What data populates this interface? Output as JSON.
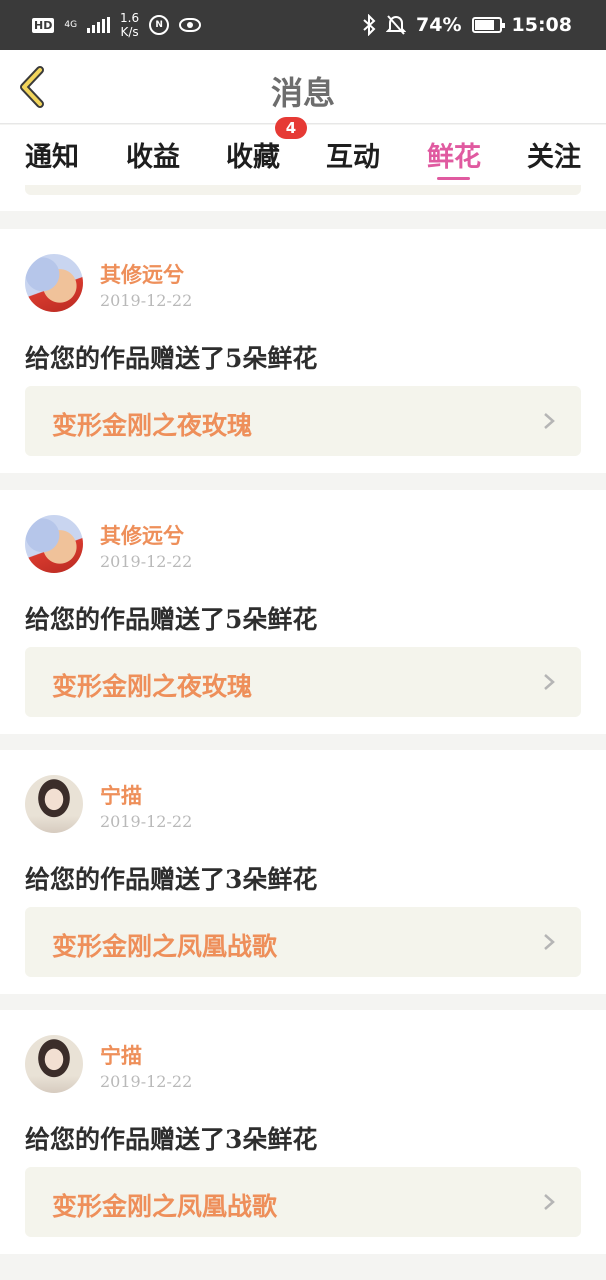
{
  "status_bar": {
    "hd": "HD",
    "network": "4G",
    "speed_value": "1.6",
    "speed_unit": "K/s",
    "circle_icon_text": "N",
    "battery": "74%",
    "time": "15:08"
  },
  "header": {
    "title": "消息"
  },
  "tabs": [
    {
      "label": "通知"
    },
    {
      "label": "收益"
    },
    {
      "label": "收藏"
    },
    {
      "label": "互动"
    },
    {
      "label": "鲜花"
    },
    {
      "label": "关注"
    }
  ],
  "active_tab": "鲜花",
  "badge": {
    "count": "4"
  },
  "colors": {
    "accent": "#e05aa0",
    "username": "#ee8f5a",
    "badge": "#e63a35"
  },
  "messages": [
    {
      "user": "其修远兮",
      "date": "2019-12-22",
      "text": "给您的作品赠送了5朵鲜花",
      "work": "变形金刚之夜玫瑰",
      "avatar": "cartoon-avatar"
    },
    {
      "user": "其修远兮",
      "date": "2019-12-22",
      "text": "给您的作品赠送了5朵鲜花",
      "work": "变形金刚之夜玫瑰",
      "avatar": "cartoon-avatar"
    },
    {
      "user": "宁描",
      "date": "2019-12-22",
      "text": "给您的作品赠送了3朵鲜花",
      "work": "变形金刚之凤凰战歌",
      "avatar": "girl-avatar"
    },
    {
      "user": "宁描",
      "date": "2019-12-22",
      "text": "给您的作品赠送了3朵鲜花",
      "work": "变形金刚之凤凰战歌",
      "avatar": "girl-avatar"
    }
  ]
}
